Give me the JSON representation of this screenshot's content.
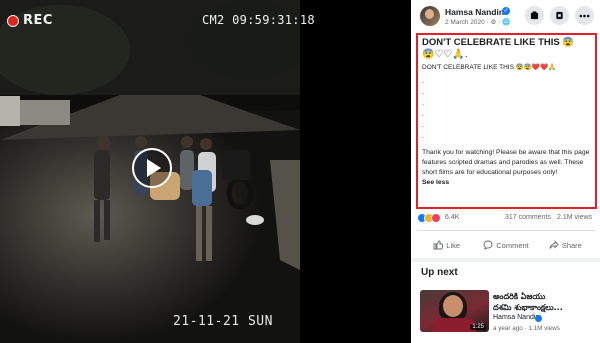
{
  "video": {
    "rec_label": "REC",
    "camera_timestamp": "CM2 09:59:31:18",
    "date_stamp": "21-11-21 SUN"
  },
  "post": {
    "poster_name": "Hamsa Nandini",
    "post_date": "2 March 2020 · ⚙ · 🌐",
    "caption_title": "DON'T CELEBRATE LIKE THIS 😨",
    "caption_emojis": "😨♡♡🙏.",
    "caption_repeat": "DON'T CELEBRATE LIKE THIS 😨😨❤️❤️🙏",
    "caption_dots": [
      ".",
      ".",
      ".",
      ".",
      ".",
      "."
    ],
    "disclaimer": "Thank you for watching! Please be aware that this page features scripted dramas and parodies as well. These short films are for educational purposes only!",
    "see_less": "See less",
    "reaction_count": "6.4K",
    "comments_count": "317 comments",
    "views_count": "2.1M views",
    "like_label": "Like",
    "comment_label": "Comment",
    "share_label": "Share"
  },
  "up_next": {
    "heading": "Up next",
    "title_line1": "అందరికి ఏజయు",
    "title_line2": "దశమి శుభాకాంక్షలు...",
    "author": "Hamsa Nandini",
    "meta": "a year ago · 1.1M views",
    "duration": "1:25"
  },
  "colors": {
    "highlight_border": "#e0232a",
    "facebook_blue": "#1877f2",
    "rec_dot": "#e0241f"
  }
}
